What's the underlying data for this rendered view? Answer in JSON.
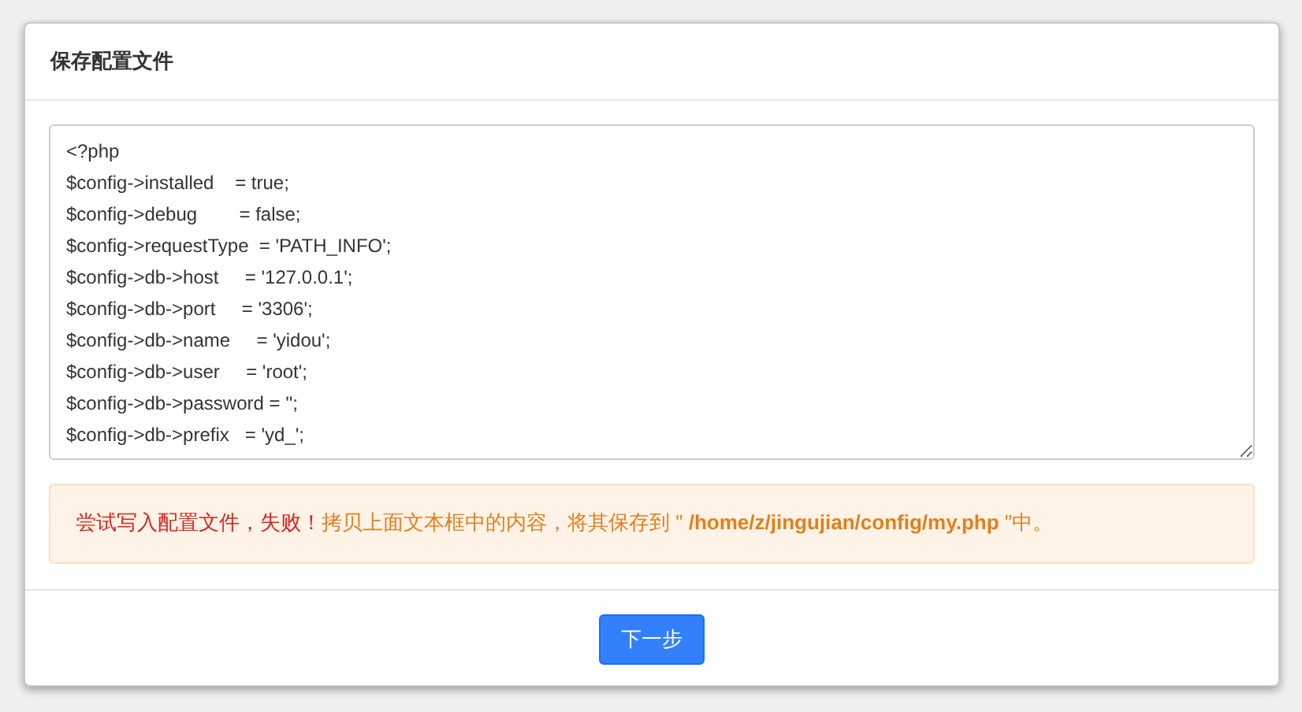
{
  "dialog": {
    "title": "保存配置文件",
    "config_text": [
      "<?php",
      "$config->installed    = true;",
      "$config->debug        = false;",
      "$config->requestType  = 'PATH_INFO';",
      "$config->db->host     = '127.0.0.1';",
      "$config->db->port     = '3306';",
      "$config->db->name     = 'yidou';",
      "$config->db->user     = 'root';",
      "$config->db->password = '';",
      "$config->db->prefix   = 'yd_';"
    ],
    "alert": {
      "error": "尝试写入配置文件，失败！",
      "instruction": "拷贝上面文本框中的内容，将其保存到 \" **/home/z/jingujian/config/my.php** \"中。"
    },
    "buttons": [
      "下一步"
    ]
  }
}
